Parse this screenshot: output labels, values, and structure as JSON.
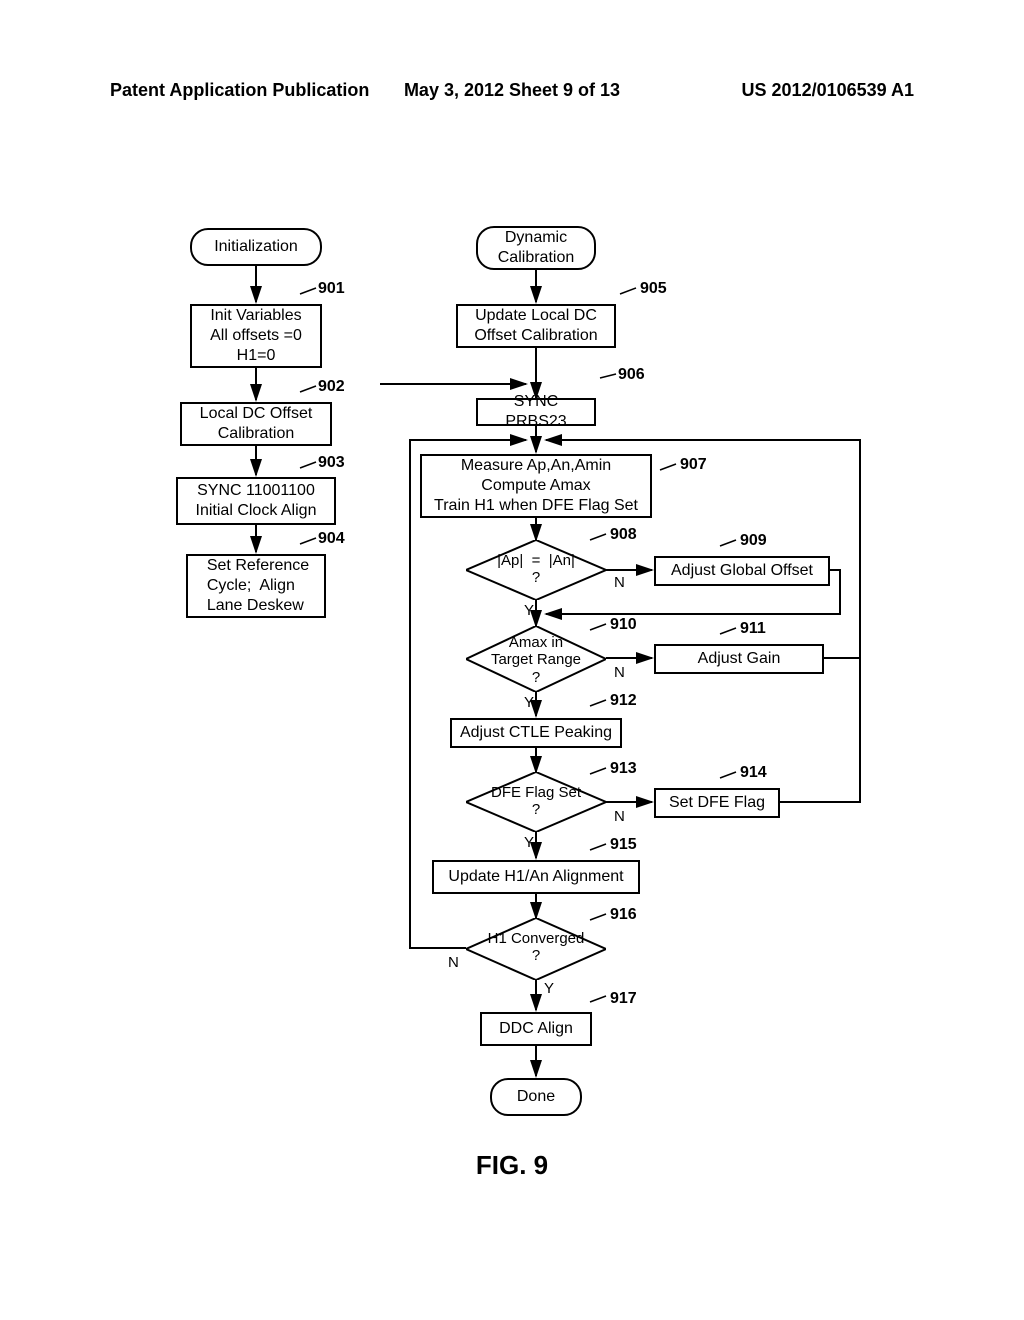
{
  "header": {
    "left": "Patent Application Publication",
    "center": "May 3, 2012  Sheet 9 of 13",
    "right": "US 2012/0106539 A1"
  },
  "figure_label": "FIG. 9",
  "left_col": {
    "start": "Initialization",
    "b901": "Init Variables\nAll offsets =0\nH1=0",
    "b902": "Local DC Offset\nCalibration",
    "b903": "SYNC 11001100\nInitial Clock Align",
    "b904": "Set Reference\nCycle;  Align\nLane Deskew"
  },
  "right_col": {
    "start": "Dynamic\nCalibration",
    "b905": "Update Local DC\nOffset Calibration",
    "b906": "SYNC PRBS23",
    "b907": "Measure Ap,An,Amin\nCompute Amax\nTrain H1 when DFE Flag Set",
    "d908": "|Ap|  =  |An|\n?",
    "b909": "Adjust Global Offset",
    "d910": "Amax in\nTarget Range\n?",
    "b911": "Adjust Gain",
    "b912": "Adjust CTLE Peaking",
    "d913": "DFE Flag Set\n?",
    "b914": "Set DFE Flag",
    "b915": "Update H1/An Alignment",
    "d916": "H1 Converged\n?",
    "b917": "DDC Align",
    "done": "Done"
  },
  "labels": {
    "n901": "901",
    "n902": "902",
    "n903": "903",
    "n904": "904",
    "n905": "905",
    "n906": "906",
    "n907": "907",
    "n908": "908",
    "n909": "909",
    "n910": "910",
    "n911": "911",
    "n912": "912",
    "n913": "913",
    "n914": "914",
    "n915": "915",
    "n916": "916",
    "n917": "917",
    "Y": "Y",
    "N": "N"
  }
}
